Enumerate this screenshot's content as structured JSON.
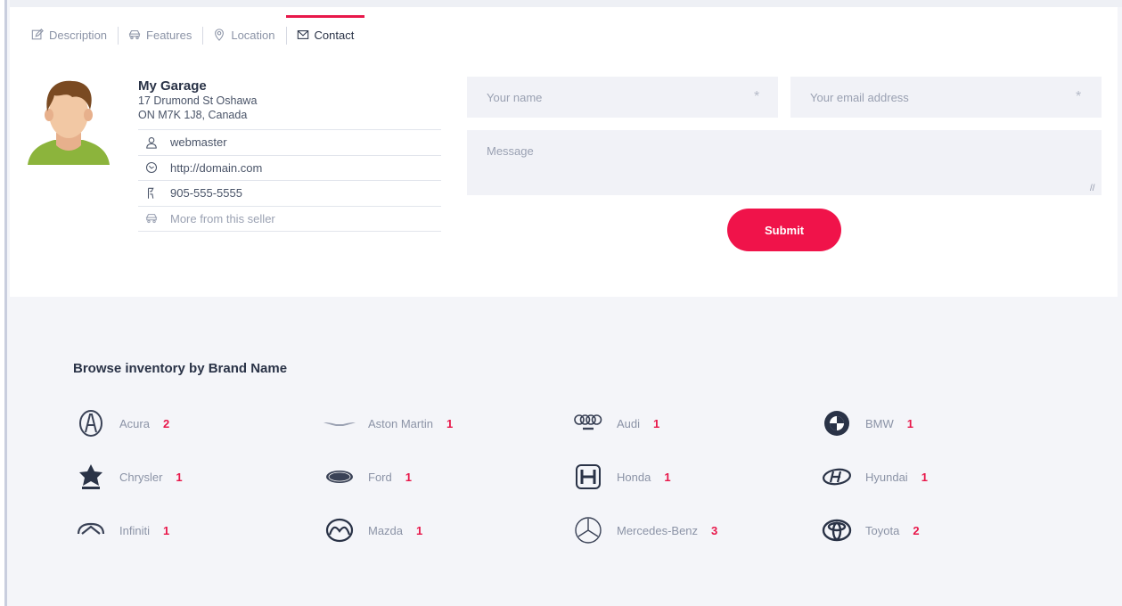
{
  "tabs": [
    {
      "label": "Description",
      "icon": "edit-icon"
    },
    {
      "label": "Features",
      "icon": "car-icon"
    },
    {
      "label": "Location",
      "icon": "location-pin-icon"
    },
    {
      "label": "Contact",
      "icon": "envelope-icon",
      "active": true
    }
  ],
  "seller": {
    "name": "My Garage",
    "address_line1": "17 Drumond St Oshawa",
    "address_line2": "ON M7K 1J8, Canada",
    "username": "webmaster",
    "website": "http://domain.com",
    "phone": "905-555-5555",
    "more_link": "More from this seller"
  },
  "form": {
    "name_placeholder": "Your name",
    "email_placeholder": "Your email address",
    "message_placeholder": "Message",
    "required_mark": "*",
    "submit_label": "Submit"
  },
  "brands": {
    "title": "Browse inventory by Brand Name",
    "items": [
      {
        "name": "Acura",
        "count": "2",
        "icon": "acura-logo-icon"
      },
      {
        "name": "Aston Martin",
        "count": "1",
        "icon": "aston-martin-logo-icon"
      },
      {
        "name": "Audi",
        "count": "1",
        "icon": "audi-logo-icon"
      },
      {
        "name": "BMW",
        "count": "1",
        "icon": "bmw-logo-icon"
      },
      {
        "name": "Chrysler",
        "count": "1",
        "icon": "chrysler-logo-icon"
      },
      {
        "name": "Ford",
        "count": "1",
        "icon": "ford-logo-icon"
      },
      {
        "name": "Honda",
        "count": "1",
        "icon": "honda-logo-icon"
      },
      {
        "name": "Hyundai",
        "count": "1",
        "icon": "hyundai-logo-icon"
      },
      {
        "name": "Infiniti",
        "count": "1",
        "icon": "infiniti-logo-icon"
      },
      {
        "name": "Mazda",
        "count": "1",
        "icon": "mazda-logo-icon"
      },
      {
        "name": "Mercedes-Benz",
        "count": "3",
        "icon": "mercedes-benz-logo-icon"
      },
      {
        "name": "Toyota",
        "count": "2",
        "icon": "toyota-logo-icon"
      }
    ]
  },
  "colors": {
    "accent": "#e8174a",
    "submit_bg": "#f0134a",
    "section_bg": "#f4f5f9"
  }
}
